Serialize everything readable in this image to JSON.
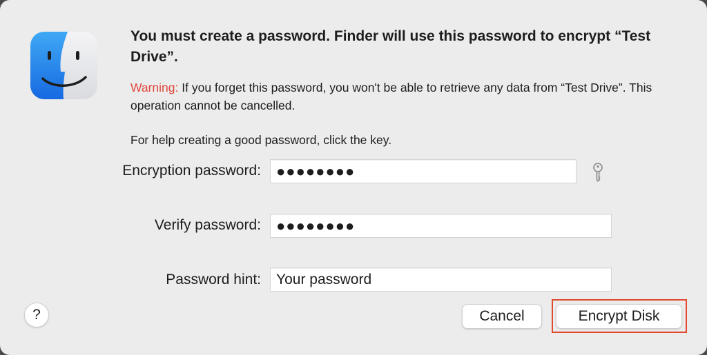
{
  "dialog": {
    "app_icon": "finder-icon",
    "title": "You must create a password. Finder will use this password to encrypt “Test Drive”.",
    "warning_label": "Warning:",
    "warning_text": " If you forget this password, you won't be able to retrieve any data from “Test Drive”. This operation cannot be cancelled.",
    "help_text": "For help creating a good password, click the key.",
    "warning_color": "#e0463b"
  },
  "form": {
    "encryption_label": "Encryption password:",
    "encryption_value": "●●●●●●●●",
    "verify_label": "Verify password:",
    "verify_value": "●●●●●●●●",
    "hint_label": "Password hint:",
    "hint_value": "Your password",
    "key_icon": "key-icon"
  },
  "buttons": {
    "help": "?",
    "cancel": "Cancel",
    "encrypt": "Encrypt Disk"
  },
  "highlight_color": "#e04a2f"
}
